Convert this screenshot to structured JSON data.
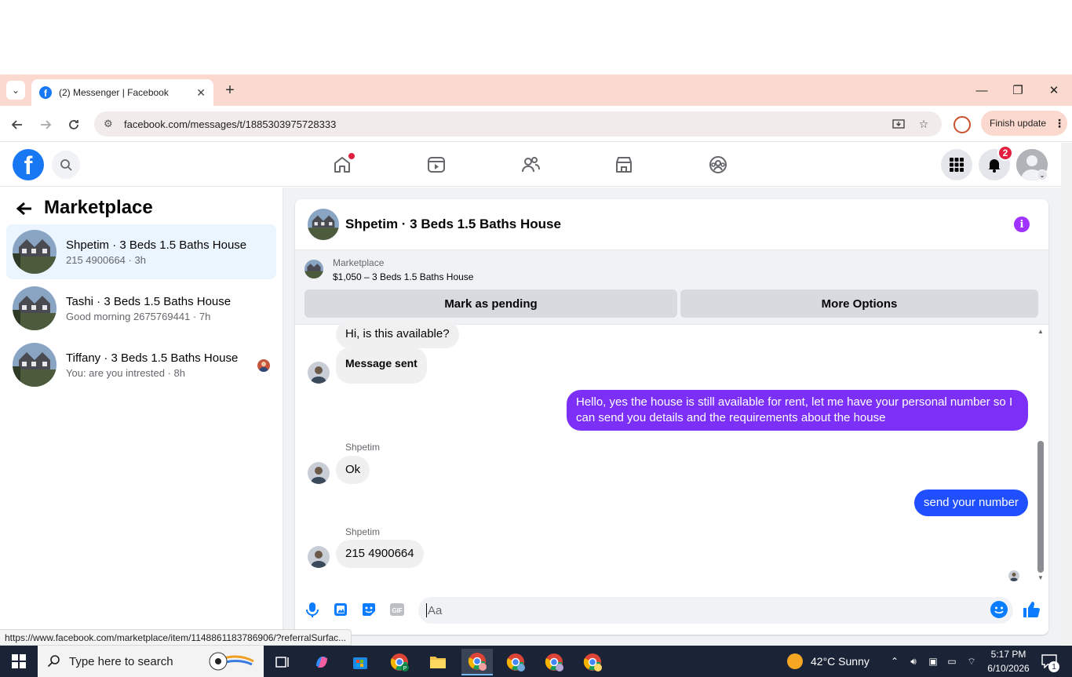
{
  "browser": {
    "tab_title": "(2) Messenger | Facebook",
    "url": "facebook.com/messages/t/1885303975728333",
    "finish_update_label": "Finish update",
    "status_url": "https://www.facebook.com/marketplace/item/1148861183786906/?referralSurfac..."
  },
  "fb_nav": {
    "notification_count": "2",
    "icons": [
      "home-icon",
      "video-icon",
      "friends-icon",
      "marketplace-icon",
      "groups-icon"
    ]
  },
  "sidebar": {
    "title": "Marketplace",
    "conversations": [
      {
        "name": "Shpetim · 3 Beds 1.5 Baths House",
        "snippet": "215 4900664 · 3h"
      },
      {
        "name": "Tashi · 3 Beds 1.5 Baths House",
        "snippet": "Good morning 2675769441 · 7h"
      },
      {
        "name": "Tiffany · 3 Beds 1.5 Baths House",
        "snippet": "You: are you intrested · 8h"
      }
    ]
  },
  "chat": {
    "header_title": "Shpetim · 3 Beds 1.5 Baths House",
    "listing": {
      "label": "Marketplace",
      "price_title": "$1,050 – 3 Beds 1.5 Baths House",
      "mark_pending": "Mark as pending",
      "more_options": "More Options"
    },
    "messages": {
      "m1": "Hi, is this available?",
      "m2": "Message sent",
      "m3": "Hello, yes the house is still available for rent, let me have your personal number so I can send you details and the requirements about the house",
      "sender1": "Shpetim",
      "m4": "Ok",
      "m5": "send your number",
      "sender2": "Shpetim",
      "m6": "215 4900664"
    },
    "composer_placeholder": "Aa"
  },
  "taskbar": {
    "search_placeholder": "Type here to search",
    "weather": "42°C  Sunny",
    "time": "5:17 PM",
    "date": "6/10/2026",
    "notifications": "1"
  },
  "colors": {
    "fb_blue": "#1877f2",
    "bubble_purple": "#7b2ff7",
    "bubble_blue": "#1f4fff",
    "tab_strip": "#fbd9cf"
  }
}
